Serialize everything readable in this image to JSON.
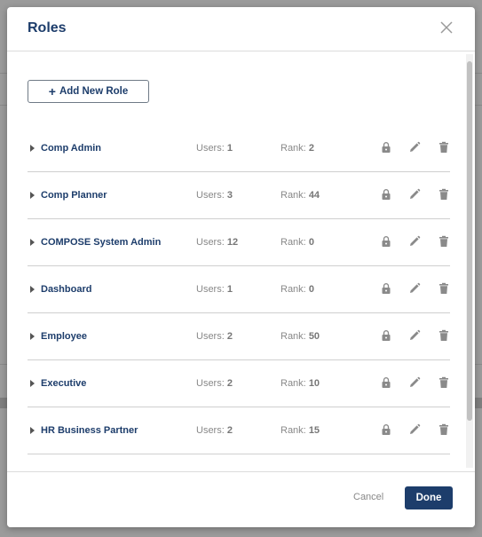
{
  "modal": {
    "title": "Roles",
    "add_button_label": "Add New Role",
    "cancel_label": "Cancel",
    "done_label": "Done"
  },
  "roles": [
    {
      "name": "Comp Admin",
      "users_label": "Users:",
      "users": "1",
      "rank_label": "Rank:",
      "rank": "2"
    },
    {
      "name": "Comp Planner",
      "users_label": "Users:",
      "users": "3",
      "rank_label": "Rank:",
      "rank": "44"
    },
    {
      "name": "COMPOSE System Admin",
      "users_label": "Users:",
      "users": "12",
      "rank_label": "Rank:",
      "rank": "0"
    },
    {
      "name": "Dashboard",
      "users_label": "Users:",
      "users": "1",
      "rank_label": "Rank:",
      "rank": "0"
    },
    {
      "name": "Employee",
      "users_label": "Users:",
      "users": "2",
      "rank_label": "Rank:",
      "rank": "50"
    },
    {
      "name": "Executive",
      "users_label": "Users:",
      "users": "2",
      "rank_label": "Rank:",
      "rank": "10"
    },
    {
      "name": "HR Business Partner",
      "users_label": "Users:",
      "users": "2",
      "rank_label": "Rank:",
      "rank": "15"
    }
  ],
  "icons": {
    "close": "close-icon",
    "plus": "plus-icon",
    "caret": "caret-right-icon",
    "lock": "lock-icon",
    "edit": "pencil-icon",
    "delete": "trash-icon"
  },
  "colors": {
    "primary": "#1d3d6b",
    "muted": "#888888",
    "icon": "#8a8a8a"
  }
}
